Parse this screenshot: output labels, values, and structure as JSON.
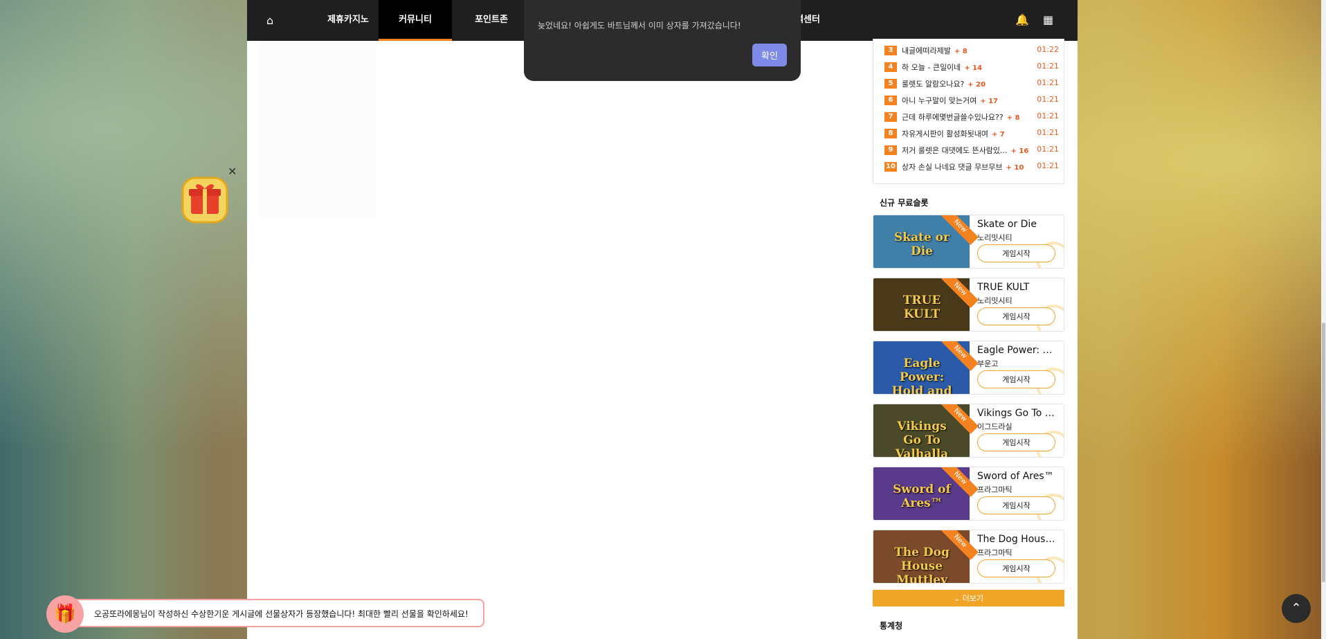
{
  "nav": {
    "items": [
      {
        "label": "제휴카지노"
      },
      {
        "label": "커뮤니티"
      },
      {
        "label": "포인트존"
      },
      {
        "label": "객센터"
      }
    ]
  },
  "modal": {
    "message": "늦었네요! 아쉽게도 바트님께서 이미 상자를 가져갔습니다!",
    "ok_label": "확인"
  },
  "ranking": [
    {
      "rank": "3",
      "title": "내글에떠라제발",
      "count": "+ 8",
      "time": "01:22"
    },
    {
      "rank": "4",
      "title": "하 오늘 - 큰일이네",
      "count": "+ 14",
      "time": "01:21"
    },
    {
      "rank": "5",
      "title": "룰렛도 알람오나요?",
      "count": "+ 20",
      "time": "01:21"
    },
    {
      "rank": "6",
      "title": "아니 누구말이 맞는거여",
      "count": "+ 17",
      "time": "01:21"
    },
    {
      "rank": "7",
      "title": "근데 하루에몇번글쓸수있나요??",
      "count": "+ 8",
      "time": "01:21"
    },
    {
      "rank": "8",
      "title": "자유게시판이 활성화됫내여",
      "count": "+ 7",
      "time": "01:21"
    },
    {
      "rank": "9",
      "title": "저거 룰렛은 대댓에도 뜬사람있...",
      "count": "+ 16",
      "time": "01:21"
    },
    {
      "rank": "10",
      "title": "상자 손실 나네요 댓글 무브무브",
      "count": "+ 10",
      "time": "01:21"
    }
  ],
  "new_slots": {
    "title": "신규 무료슬롯",
    "ribbon": "New",
    "play_label": "게임시작",
    "items": [
      {
        "name": "Skate or Die",
        "provider": "노리밋시티",
        "thumb_color": "#3f7fa8"
      },
      {
        "name": "TRUE KULT",
        "provider": "노리밋시티",
        "thumb_color": "#4a3a1a"
      },
      {
        "name": "Eagle Power: Hold and Win",
        "provider": "부운고",
        "thumb_color": "#2a5aa8"
      },
      {
        "name": "Vikings Go To Valhalla",
        "provider": "이그드라실",
        "thumb_color": "#4a4a2a"
      },
      {
        "name": "Sword of Ares™",
        "provider": "프라그마틱",
        "thumb_color": "#5a3a8a"
      },
      {
        "name": "The Dog House Muttley Crew",
        "provider": "프라그마틱",
        "thumb_color": "#7a4a2a"
      }
    ]
  },
  "more_label": "더보기",
  "stats_title": "통계청",
  "toast": {
    "message": "오공또라에몽님이 작성하신 수상한기운 게시글에 선물상자가 등장했습니다! 최대한 빨리 선물을 확인하세요!"
  },
  "icons": {
    "home": "home-icon",
    "bell": "bell-icon",
    "grid": "grid-icon",
    "gift": "gift-icon",
    "close": "close-icon",
    "chevron_up": "chevron-up-icon",
    "chevron_down": "chevron-down-icon"
  },
  "colors": {
    "accent": "#f58220",
    "more_button": "#f0a428",
    "ok_button": "#7d8ae8"
  }
}
